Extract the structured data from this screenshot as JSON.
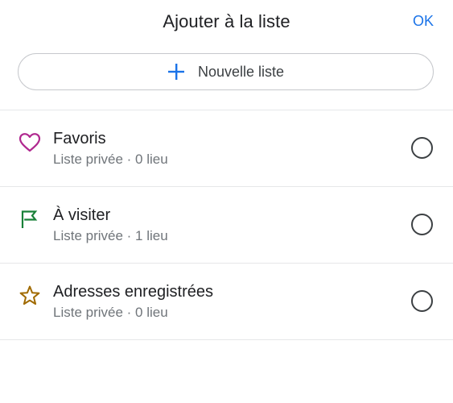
{
  "header": {
    "title": "Ajouter à la liste",
    "ok_label": "OK"
  },
  "new_list": {
    "label": "Nouvelle liste",
    "icon": "plus-icon"
  },
  "lists": [
    {
      "name": "Favoris",
      "subtitle": "Liste privée · 0 lieu",
      "icon": "heart-icon",
      "icon_color": "#b0288f",
      "selected": false
    },
    {
      "name": "À visiter",
      "subtitle": "Liste privée · 1 lieu",
      "icon": "flag-icon",
      "icon_color": "#188038",
      "selected": false
    },
    {
      "name": "Adresses enregistrées",
      "subtitle": "Liste privée · 0 lieu",
      "icon": "star-icon",
      "icon_color": "#a06a00",
      "selected": false
    }
  ],
  "colors": {
    "accent": "#1a73e8",
    "divider": "#e6e7e9"
  }
}
